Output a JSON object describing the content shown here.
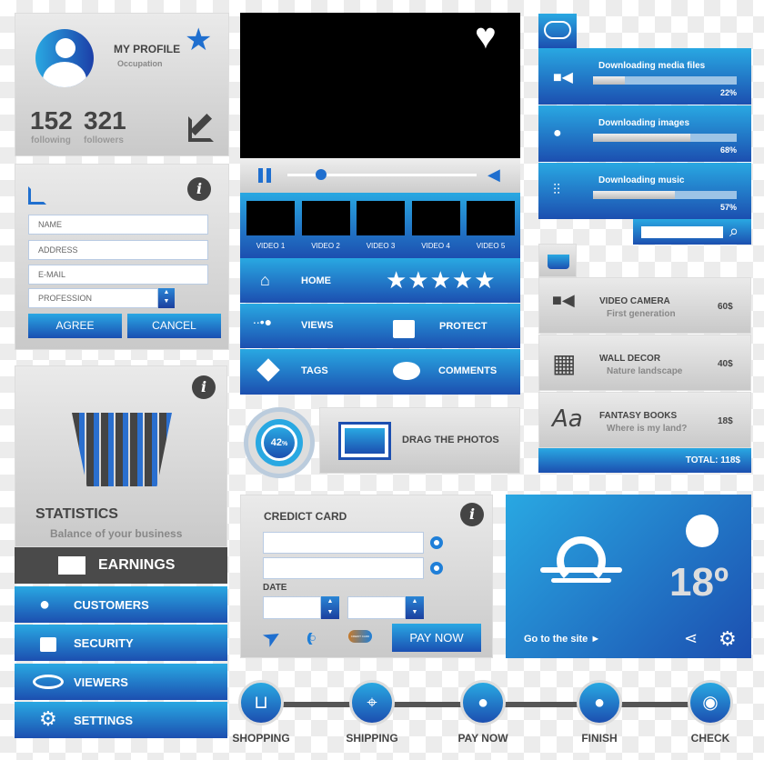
{
  "profile": {
    "title": "MY PROFILE",
    "subtitle": "Occupation",
    "following_count": "152",
    "following_label": "following",
    "followers_count": "321",
    "followers_label": "followers"
  },
  "form": {
    "name_placeholder": "NAME",
    "address_placeholder": "ADDRESS",
    "email_placeholder": "E-MAIL",
    "profession_placeholder": "PROFESSION",
    "agree": "AGREE",
    "cancel": "CANCEL"
  },
  "stats": {
    "title": "STATISTICS",
    "subtitle": "Balance of your business",
    "menu": [
      {
        "label": "EARNINGS",
        "icon": "folder-icon"
      },
      {
        "label": "CUSTOMERS",
        "icon": "user-icon"
      },
      {
        "label": "SECURITY",
        "icon": "lock-icon"
      },
      {
        "label": "VIEWERS",
        "icon": "eye-icon"
      },
      {
        "label": "SETTINGS",
        "icon": "gear-icon"
      }
    ]
  },
  "video": {
    "progress": 0.18,
    "thumbs": [
      "VIDEO 1",
      "VIDEO 2",
      "VIDEO 3",
      "VIDEO 4",
      "VIDEO 5"
    ],
    "menu": [
      {
        "label": "HOME",
        "icon": "home-icon"
      },
      {
        "label": "rating",
        "stars": 5
      },
      {
        "label": "VIEWS",
        "icon": "graph-icon"
      },
      {
        "label": "PROTECT",
        "icon": "lock-icon"
      },
      {
        "label": "TAGS",
        "icon": "tag-icon"
      },
      {
        "label": "COMMENTS",
        "icon": "comment-icon"
      }
    ]
  },
  "progress_circle": {
    "value": "42",
    "unit": "%"
  },
  "drag": {
    "label": "DRAG THE PHOTOS"
  },
  "downloads": [
    {
      "label": "Downloading media files",
      "percent": 22,
      "icon": "video-camera-icon"
    },
    {
      "label": "Downloading images",
      "percent": 68,
      "icon": "camera-icon"
    },
    {
      "label": "Downloading music",
      "percent": 57,
      "icon": "equalizer-icon"
    }
  ],
  "cart": {
    "items": [
      {
        "name": "VIDEO CAMERA",
        "desc": "First generation",
        "price": "60$"
      },
      {
        "name": "WALL DECOR",
        "desc": "Nature landscape",
        "price": "40$"
      },
      {
        "name": "FANTASY BOOKS",
        "desc": "Where is my land?",
        "price": "18$"
      }
    ],
    "total": "TOTAL: 118$",
    "font_icon_text": "Aa"
  },
  "card": {
    "title": "CREDICT CARD",
    "date_label": "DATE",
    "pay": "PAY NOW",
    "credit_logo": "CREDIT CARD"
  },
  "weather": {
    "temp": "18º",
    "link": "Go to the site ►"
  },
  "steps": [
    "SHOPPING",
    "SHIPPING",
    "PAY NOW",
    "FINISH",
    "CHECK"
  ],
  "colors": {
    "accent": "#1c4fb0",
    "accent_light": "#29a8e2",
    "dark": "#444444"
  }
}
